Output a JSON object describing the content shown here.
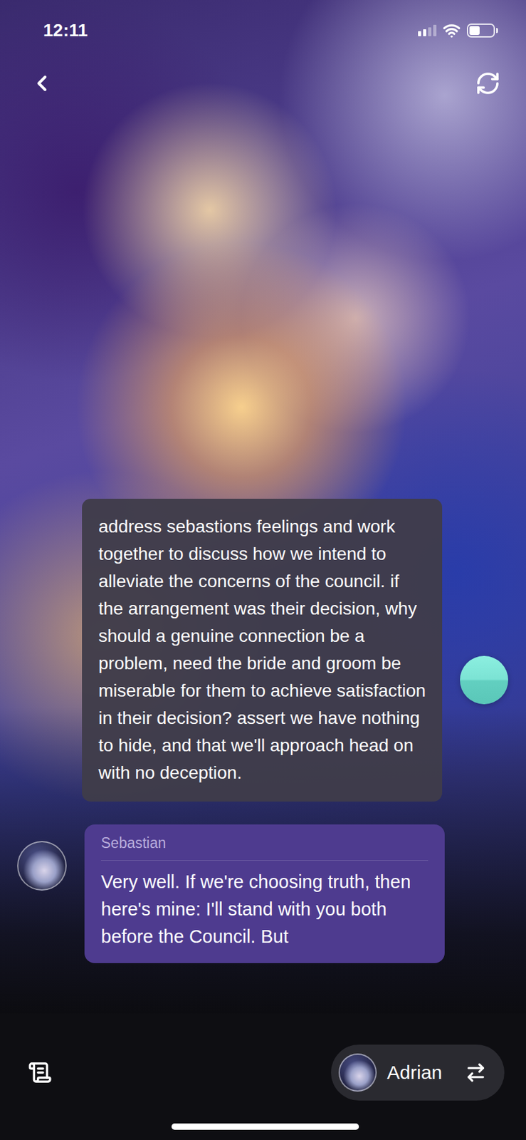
{
  "status_bar": {
    "time": "12:11",
    "signal_level": 0.5,
    "battery_level": 0.45
  },
  "messages": [
    {
      "kind": "user",
      "text": "address sebastions feelings and work together to discuss how we intend to alleviate the concerns of the council. if the arrangement was their decision, why should a genuine connection be a problem, need the bride and groom be miserable for them to achieve satisfaction in their decision? assert we have nothing to hide, and that we'll approach head on with no deception."
    },
    {
      "kind": "character",
      "name": "Sebastian",
      "text": "Very well. If we're choosing truth, then here's mine: I'll stand with you both before the Council. But"
    }
  ],
  "persona": {
    "name": "Adrian"
  }
}
